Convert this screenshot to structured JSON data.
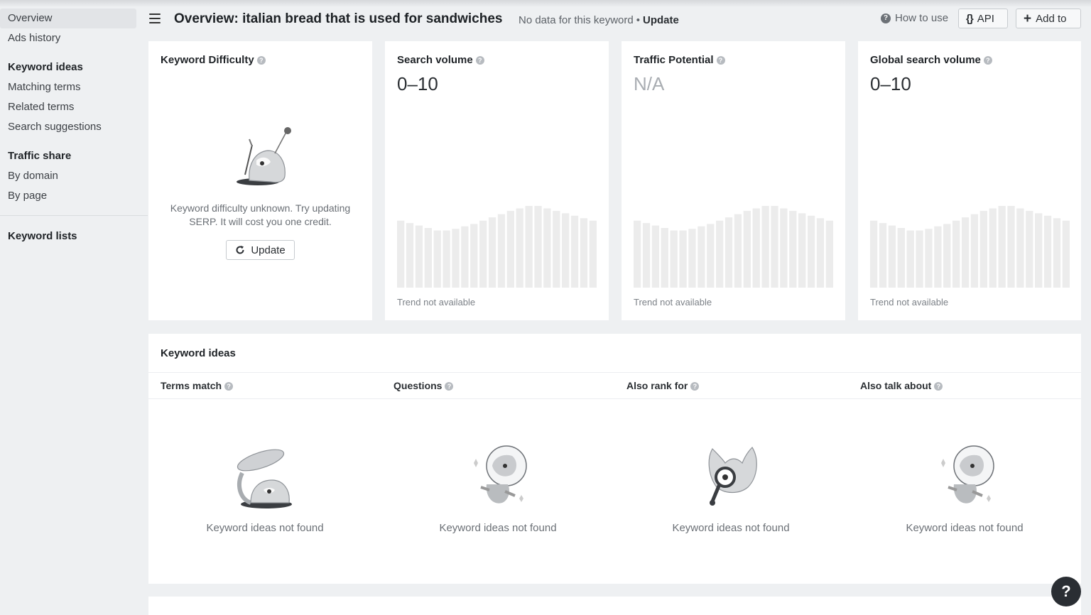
{
  "sidebar": {
    "items": [
      {
        "label": "Overview"
      },
      {
        "label": "Ads history"
      },
      {
        "label": "Keyword ideas"
      },
      {
        "label": "Matching terms"
      },
      {
        "label": "Related terms"
      },
      {
        "label": "Search suggestions"
      },
      {
        "label": "Traffic share"
      },
      {
        "label": "By domain"
      },
      {
        "label": "By page"
      },
      {
        "label": "Keyword lists"
      }
    ]
  },
  "header": {
    "title": "Overview: italian bread that is used for sandwiches",
    "no_data": "No data for this keyword",
    "separator": "•",
    "update_link": "Update",
    "how_to_use": "How to use",
    "api_label": "API",
    "add_to_label": "Add to"
  },
  "metrics": {
    "keyword_difficulty": {
      "title": "Keyword Difficulty",
      "message": "Keyword difficulty unknown. Try updating SERP. It will cost you one credit.",
      "update_label": "Update"
    },
    "search_volume": {
      "title": "Search volume",
      "value": "0–10",
      "trend_label": "Trend not available"
    },
    "traffic_potential": {
      "title": "Traffic Potential",
      "value": "N/A",
      "trend_label": "Trend not available"
    },
    "global_search_volume": {
      "title": "Global search volume",
      "value": "0–10",
      "trend_label": "Trend not available"
    }
  },
  "trend_placeholder": [
    0.82,
    0.79,
    0.76,
    0.73,
    0.7,
    0.7,
    0.72,
    0.75,
    0.78,
    0.82,
    0.86,
    0.9,
    0.94,
    0.97,
    1.0,
    1.0,
    0.97,
    0.94,
    0.91,
    0.88,
    0.85,
    0.82
  ],
  "keyword_ideas": {
    "title": "Keyword ideas",
    "columns": [
      {
        "label": "Terms match",
        "empty": "Keyword ideas not found"
      },
      {
        "label": "Questions",
        "empty": "Keyword ideas not found"
      },
      {
        "label": "Also rank for",
        "empty": "Keyword ideas not found"
      },
      {
        "label": "Also talk about",
        "empty": "Keyword ideas not found"
      }
    ]
  },
  "help_button": "?",
  "colors": {
    "background": "#eef0f2",
    "card": "#ffffff",
    "trend_bar": "#ececec",
    "help_fab": "#2a2e33"
  }
}
